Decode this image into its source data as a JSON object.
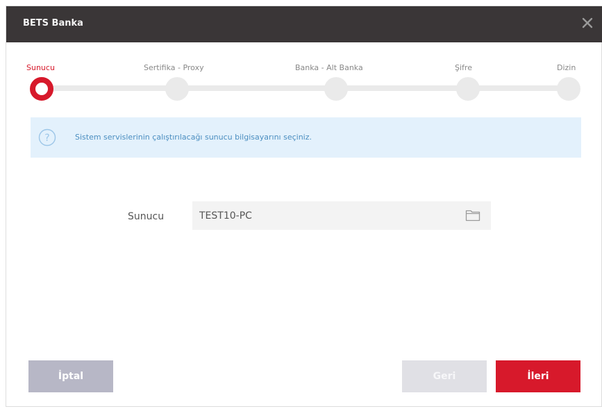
{
  "window": {
    "title": "BETS Banka",
    "close_icon": "close-icon"
  },
  "stepper": {
    "active_index": 0,
    "steps": [
      {
        "label": "Sunucu"
      },
      {
        "label": "Sertifika - Proxy"
      },
      {
        "label": "Banka - Alt Banka"
      },
      {
        "label": "Şifre"
      },
      {
        "label": "Dizin"
      }
    ]
  },
  "info": {
    "icon": "question-circle-icon",
    "text": "Sistem servislerinin çalıştırılacağı sunucu bilgisayarını seçiniz."
  },
  "form": {
    "server_label": "Sunucu",
    "server_value": "TEST10-PC",
    "browse_icon": "folder-icon"
  },
  "footer": {
    "cancel_label": "İptal",
    "back_label": "Geri",
    "next_label": "İleri"
  },
  "colors": {
    "accent": "#d7192b",
    "titlebar": "#3a3637",
    "info_bg": "#e3f1fc",
    "info_text": "#4b8ec0"
  }
}
